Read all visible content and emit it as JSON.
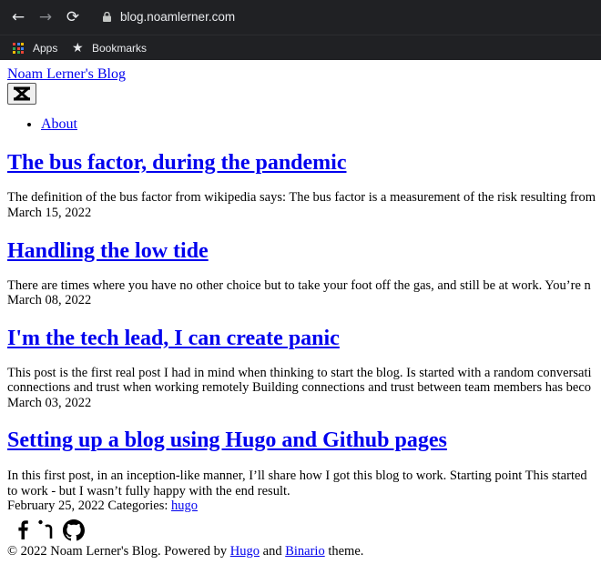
{
  "browser": {
    "url": "blog.noamlerner.com",
    "bookmarks": [
      {
        "label": "Apps",
        "icon": "apps-grid-icon"
      },
      {
        "label": "Bookmarks",
        "icon": "star-icon"
      }
    ]
  },
  "site": {
    "title": "Noam Lerner's Blog",
    "nav": [
      {
        "label": "About"
      }
    ]
  },
  "posts": [
    {
      "title": "The bus factor, during the pandemic",
      "summary_lines": [
        "The definition of the bus factor from wikipedia says: The bus factor is a measurement of the risk resulting from"
      ],
      "date": "March 15, 2022"
    },
    {
      "title": "Handling the low tide",
      "summary_lines": [
        "There are times where you have no other choice but to take your foot off the gas, and still be at work. You’re n"
      ],
      "date": "March 08, 2022"
    },
    {
      "title": "I'm the tech lead, I can create panic",
      "summary_lines": [
        "This post is the first real post I had in mind when thinking to start the blog. Is started with a random conversati",
        "connections and trust when working remotely Building connections and trust between team members has beco"
      ],
      "date": "March 03, 2022"
    },
    {
      "title": "Setting up a blog using Hugo and Github pages",
      "summary_lines": [
        "In this first post, in an inception-like manner, I’ll share how I got this blog to work. Starting point This started",
        "to work - but I wasn’t fully happy with the end result."
      ],
      "date": "February 25, 2022",
      "categories_label": "Categories:",
      "category": "hugo"
    }
  ],
  "social_icons": [
    "facebook-icon",
    "linkedin-icon",
    "github-icon"
  ],
  "footer": {
    "prefix": "© 2022 Noam Lerner's Blog. Powered by",
    "link1": "Hugo",
    "and": "and",
    "link2": "Binario",
    "suffix": "theme."
  },
  "colors": {
    "chrome_bg": "#202124",
    "chrome_text": "#e8eaed",
    "link": "#0000ee",
    "text": "#000000",
    "page_bg": "#ffffff"
  }
}
